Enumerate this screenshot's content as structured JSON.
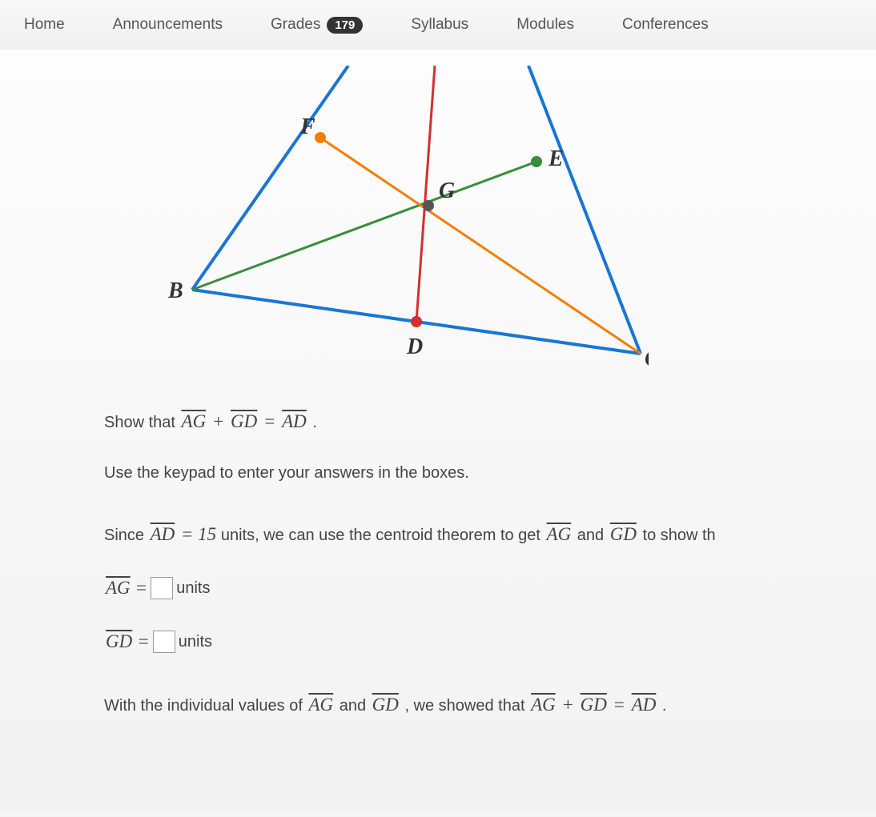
{
  "nav": {
    "home": "Home",
    "announcements": "Announcements",
    "grades": "Grades",
    "grades_badge": "179",
    "syllabus": "Syllabus",
    "modules": "Modules",
    "conferences": "Conferences"
  },
  "diagram": {
    "labels": {
      "B": "B",
      "C": "C",
      "D": "D",
      "E": "E",
      "F": "F",
      "G": "G"
    },
    "colors": {
      "triangle": "#1976d2",
      "median_ad": "#d32f2f",
      "median_be": "#388e3c",
      "median_cf": "#f57c00",
      "point_fill": {
        "F": "#f57c00",
        "E": "#388e3c",
        "G": "#555",
        "D": "#d32f2f"
      }
    }
  },
  "problem": {
    "show_that_prefix": "Show that ",
    "seg_AG": "AG",
    "plus": " + ",
    "seg_GD": "GD",
    "equals": " = ",
    "seg_AD": "AD",
    "period": ".",
    "instruction": "Use the keypad to enter your answers in the boxes.",
    "since_prefix": "Since ",
    "ad_value": " = 15 ",
    "since_suffix": "units, we can use the centroid theorem to get ",
    "and": " and ",
    "to_show": " to show th",
    "units": " units",
    "conclusion_prefix": "With the individual values of ",
    "conclusion_mid": ", we showed that "
  }
}
